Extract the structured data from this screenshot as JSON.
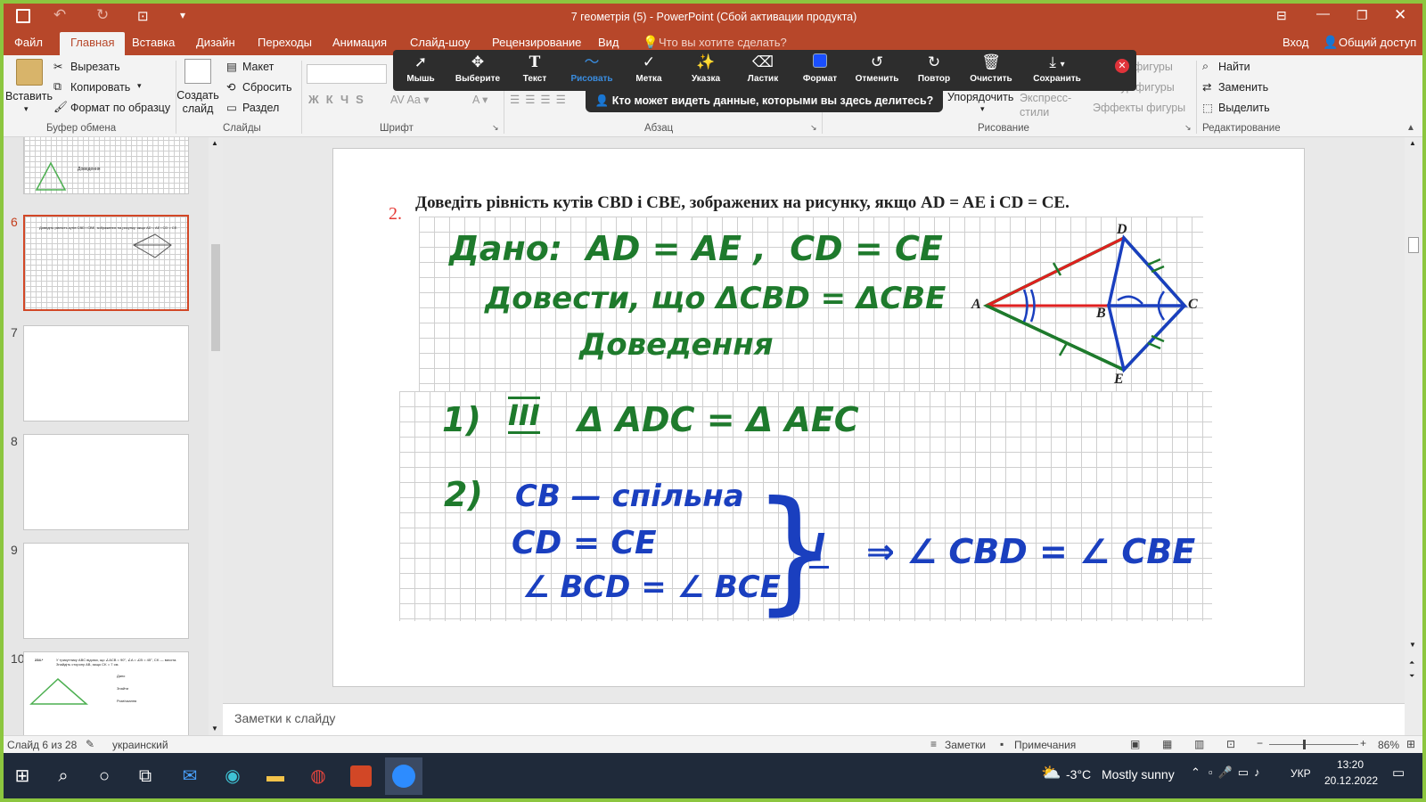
{
  "window": {
    "title": "7 геометрія (5) - PowerPoint (Сбой активации продукта)"
  },
  "tabs": [
    "Файл",
    "Главная",
    "Вставка",
    "Дизайн",
    "Переходы",
    "Анимация",
    "Слайд-шоу",
    "Рецензирование",
    "Вид"
  ],
  "tell_me": "Что вы хотите сделать?",
  "account": {
    "login": "Вход",
    "share": "Общий доступ"
  },
  "ribbon": {
    "paste": "Вставить",
    "cut": "Вырезать",
    "copy": "Копировать",
    "format_painter": "Формат по образцу",
    "clipboard_group": "Буфер обмена",
    "new_slide": "Создать слайд",
    "layout": "Макет",
    "reset": "Сбросить",
    "section": "Раздел",
    "slides_group": "Слайды",
    "font_group": "Шрифт",
    "paragraph_group": "Абзац",
    "arrange": "Упорядочить",
    "quick_styles": "Экспресс-стили",
    "shape_fill": "фигуры",
    "shape_outline": "контур фигуры",
    "shape_effects": "Эффекты фигуры",
    "drawing_group": "Рисование",
    "find": "Найти",
    "replace": "Заменить",
    "select": "Выделить",
    "editing_group": "Редактирование"
  },
  "zoom_toolbar": {
    "tools": [
      {
        "label": "Мышь",
        "icon": "cursor-icon"
      },
      {
        "label": "Выберите",
        "icon": "move-icon"
      },
      {
        "label": "Текст",
        "icon": "text-icon"
      },
      {
        "label": "Рисовать",
        "icon": "draw-icon"
      },
      {
        "label": "Метка",
        "icon": "check-icon"
      },
      {
        "label": "Указка",
        "icon": "spotlight-icon"
      },
      {
        "label": "Ластик",
        "icon": "eraser-icon"
      },
      {
        "label": "Формат",
        "icon": "format-icon"
      },
      {
        "label": "Отменить",
        "icon": "undo-icon"
      },
      {
        "label": "Повтор",
        "icon": "redo-icon"
      },
      {
        "label": "Очистить",
        "icon": "trash-icon"
      },
      {
        "label": "Сохранить",
        "icon": "save-icon"
      }
    ],
    "share_notice": "Кто может видеть данные, которыми вы здесь делитесь?"
  },
  "thumbnails": {
    "numbers": [
      "6",
      "7",
      "8",
      "9",
      "10"
    ],
    "t5_label": "Доведення",
    "t6_text": "Доведіть рівність кутів CBD і CBE, зображених на рисунку, якщо AD = AE і CD = CE.",
    "t10_text": "У трикутнику ABC відомо, що ∠ACB = 90°, ∠A = ∠B = 45°, CK — висота. Знайдіть сторону AB, якщо CK = 7 см.",
    "t10_num": "234.*",
    "t10_a": "Дано",
    "t10_b": "Знайти",
    "t10_c": "Розв'язання"
  },
  "slide": {
    "number": "2.",
    "problem": "Доведіть рівність кутів CBD і CBE, зображених на рисунку, якщо AD = AE і CD = CE.",
    "handwriting": {
      "given": "Дано:  AD = AE ,  CD = CE",
      "prove": "Довести, що ΔCBD = ΔCBE",
      "proof": "Доведення",
      "step1_num": "1)",
      "step1_sign": "III",
      "step1": "Δ ADC = Δ AEC",
      "step2_num": "2)",
      "line1": "CB — спільна",
      "line2": "CD = CE",
      "line3": "∠ BCD = ∠ BCE",
      "sign": "I",
      "conclusion": "⇒ ∠ CBD = ∠ CBE"
    },
    "figure_labels": {
      "A": "A",
      "B": "B",
      "C": "C",
      "D": "D",
      "E": "E"
    }
  },
  "notes_placeholder": "Заметки к слайду",
  "status": {
    "slide_of": "Слайд 6 из 28",
    "language": "украинский",
    "notes": "Заметки",
    "comments": "Примечания",
    "zoom_level": "86%"
  },
  "taskbar": {
    "weather_temp": "-3°C",
    "weather_text": "Mostly sunny",
    "lang": "УКР",
    "time": "13:20",
    "date": "20.12.2022"
  },
  "colors": {
    "accent": "#b7472a",
    "ink_green": "#1e7a2c",
    "ink_blue": "#1a3fbf",
    "ink_red": "#e02020"
  }
}
